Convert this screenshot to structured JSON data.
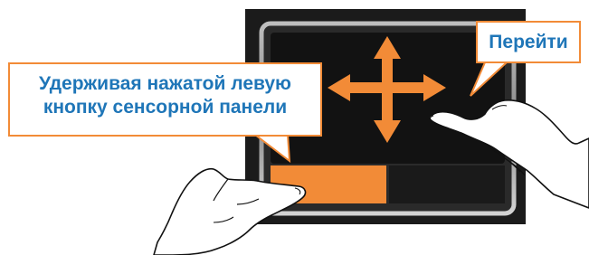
{
  "callouts": {
    "hold": {
      "line1": "Удерживая нажатой левую",
      "line2": "кнопку сенсорной панели"
    },
    "move": {
      "text": "Перейти"
    }
  },
  "icons": {
    "arrows": "four-direction-move-icon",
    "left_hand": "finger-press-hand-icon",
    "right_hand": "finger-swipe-hand-icon"
  },
  "colors": {
    "accent": "#f28b37",
    "text": "#1f76b8",
    "touchpad": "#121212",
    "bezel": "#2a2a2a",
    "outer_frame": "#1b1b1b"
  }
}
